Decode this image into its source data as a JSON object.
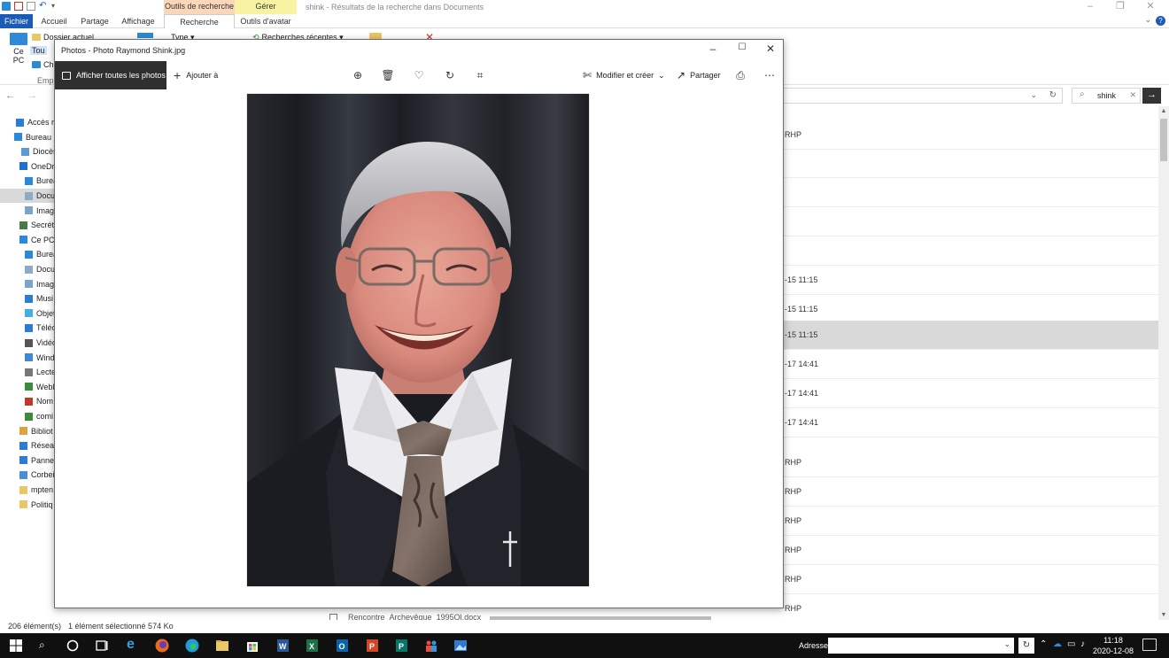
{
  "explorer": {
    "window_title": "shink - Résultats de la recherche dans Documents",
    "context_tabs": {
      "search_tools": "Outils de recherche",
      "manage": "Gérer"
    },
    "tabs": [
      {
        "label": "Fichier"
      },
      {
        "label": "Accueil"
      },
      {
        "label": "Partage"
      },
      {
        "label": "Affichage"
      },
      {
        "label": "Recherche"
      },
      {
        "label": "Outils d'avatar"
      }
    ],
    "ribbon": {
      "this_pc_line1": "Ce",
      "this_pc_line2": "PC",
      "current_folder": "Dossier actuel",
      "all_subfolders": "Tou",
      "other": "Che",
      "type": "Type ▾",
      "recent_searches": "Recherches récentes ▾",
      "group_location": "Empl"
    },
    "search": {
      "value": "shink"
    },
    "nav_pane": [
      {
        "label": "Accès ra",
        "icon": "star-icon",
        "color": "#2b7cd3"
      },
      {
        "label": "Bureau",
        "icon": "desktop-icon",
        "color": "#2b8ad8"
      },
      {
        "label": "Diocès",
        "icon": "file-icon",
        "color": "#5b9bd5"
      },
      {
        "label": "OneDr",
        "icon": "cloud-icon",
        "color": "#1f6fd1"
      },
      {
        "label": "Burea",
        "icon": "desktop-icon",
        "color": "#2b8ad8"
      },
      {
        "label": "Docu",
        "icon": "document-icon",
        "color": "#8fa9c9"
      },
      {
        "label": "Imag",
        "icon": "image-icon",
        "color": "#7aa5c8"
      },
      {
        "label": "Secréta",
        "icon": "user-icon",
        "color": "#4a7a4a"
      },
      {
        "label": "Ce PC",
        "icon": "computer-icon",
        "color": "#2b8ad8"
      },
      {
        "label": "Burea",
        "icon": "desktop-icon",
        "color": "#2b8ad8"
      },
      {
        "label": "Docu",
        "icon": "document-icon",
        "color": "#8fa9c9"
      },
      {
        "label": "Imag",
        "icon": "image-icon",
        "color": "#7aa5c8"
      },
      {
        "label": "Musi",
        "icon": "music-icon",
        "color": "#2b7cd3"
      },
      {
        "label": "Objet",
        "icon": "cube-icon",
        "color": "#43b0e0"
      },
      {
        "label": "Téléc",
        "icon": "download-icon",
        "color": "#2b7cd3"
      },
      {
        "label": "Vidéo",
        "icon": "video-icon",
        "color": "#555555"
      },
      {
        "label": "Wind",
        "icon": "drive-icon",
        "color": "#3c8ad6"
      },
      {
        "label": "Lecte",
        "icon": "drive-icon",
        "color": "#777777"
      },
      {
        "label": "Webl",
        "icon": "network-drive-icon",
        "color": "#3a8b3a"
      },
      {
        "label": "Nom",
        "icon": "network-drive-icon",
        "color": "#c0392b"
      },
      {
        "label": "comi",
        "icon": "network-drive-icon",
        "color": "#3a8b3a"
      },
      {
        "label": "Bibliot",
        "icon": "library-icon",
        "color": "#d9a441"
      },
      {
        "label": "Réseau",
        "icon": "network-icon",
        "color": "#2b7cd3"
      },
      {
        "label": "Panne",
        "icon": "control-panel-icon",
        "color": "#2b7cd3"
      },
      {
        "label": "Corbei",
        "icon": "recycle-bin-icon",
        "color": "#4a8fd1"
      },
      {
        "label": "mpten",
        "icon": "folder-icon",
        "color": "#e9c766"
      },
      {
        "label": "Politiq",
        "icon": "folder-icon",
        "color": "#e9c766"
      }
    ],
    "results": [
      {
        "text": "RHP"
      },
      {
        "text": ""
      },
      {
        "text": ""
      },
      {
        "text": ""
      },
      {
        "text": ""
      },
      {
        "text": "-15 11:15"
      },
      {
        "text": "-15 11:15"
      },
      {
        "text": "-15 11:15"
      },
      {
        "text": "-17 14:41"
      },
      {
        "text": "-17 14:41"
      },
      {
        "text": "-17 14:41"
      },
      {
        "text": "RHP"
      },
      {
        "text": "RHP"
      },
      {
        "text": "RHP"
      },
      {
        "text": "RHP"
      },
      {
        "text": "RHP"
      },
      {
        "text": "RHP"
      }
    ],
    "partial_row_text": "Rencontre_Archevêque_1995Ol.docx",
    "status": {
      "count": "206 élément(s)",
      "selection": "1 élément sélectionné  574 Ko"
    }
  },
  "photos_app": {
    "title": "Photos - Photo Raymond Shink.jpg",
    "show_all": "Afficher toutes les photos",
    "add_to": "Ajouter à",
    "edit_create": "Modifier et créer",
    "share": "Partager"
  },
  "taskbar": {
    "address_label": "Adresse",
    "time": "11:18",
    "date": "2020-12-08"
  }
}
